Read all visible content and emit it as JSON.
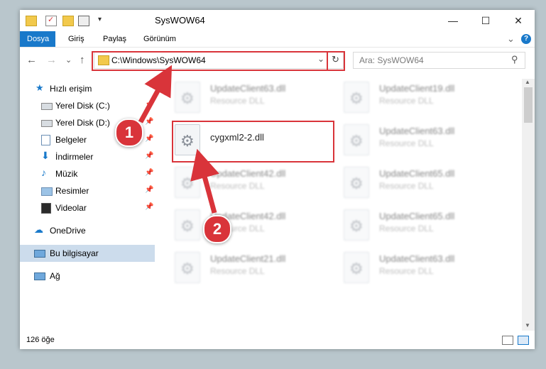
{
  "window": {
    "title": "SysWOW64",
    "minimize_glyph": "—",
    "maximize_glyph": "☐",
    "close_glyph": "✕"
  },
  "ribbon": {
    "tabs": [
      "Dosya",
      "Giriş",
      "Paylaş",
      "Görünüm"
    ],
    "expand_glyph": "⌄",
    "help_glyph": "?"
  },
  "navbar": {
    "back_glyph": "←",
    "forward_glyph": "→",
    "recent_glyph": "⌄",
    "up_glyph": "↑",
    "address": "C:\\Windows\\SysWOW64",
    "refresh_glyph": "↻",
    "search_placeholder": "Ara: SysWOW64",
    "search_glyph": "⚲"
  },
  "sidebar": {
    "items": [
      {
        "label": "Hızlı erişim",
        "icon": "star-icon"
      },
      {
        "label": "Yerel Disk (C:)",
        "icon": "drive-icon"
      },
      {
        "label": "Yerel Disk (D:)",
        "icon": "drive-icon"
      },
      {
        "label": "Belgeler",
        "icon": "documents-icon"
      },
      {
        "label": "İndirmeler",
        "icon": "download-icon"
      },
      {
        "label": "Müzik",
        "icon": "music-icon"
      },
      {
        "label": "Resimler",
        "icon": "pictures-icon"
      },
      {
        "label": "Videolar",
        "icon": "video-icon"
      },
      {
        "label": "OneDrive",
        "icon": "cloud-icon"
      },
      {
        "label": "Bu bilgisayar",
        "icon": "computer-icon"
      },
      {
        "label": "Ağ",
        "icon": "network-icon"
      }
    ],
    "pin_glyph": "📌"
  },
  "files": {
    "highlighted": {
      "name": "cygxml2-2.dll"
    },
    "left_column": [
      {
        "name": "UpdateClient63.dll",
        "type": "Resource DLL"
      },
      {
        "name": "UpdateClient42.dll",
        "type": "Resource DLL"
      },
      {
        "name": "UpdateClient42.dll",
        "type": "Resource DLL"
      },
      {
        "name": "UpdateClient21.dll",
        "type": "Resource DLL"
      }
    ],
    "right_column": [
      {
        "name": "UpdateClient19.dll",
        "type": "Resource DLL"
      },
      {
        "name": "UpdateClient63.dll",
        "type": "Resource DLL"
      },
      {
        "name": "UpdateClient65.dll",
        "type": "Resource DLL"
      },
      {
        "name": "UpdateClient65.dll",
        "type": "Resource DLL"
      },
      {
        "name": "UpdateClient63.dll",
        "type": "Resource DLL"
      }
    ]
  },
  "status": {
    "item_count": "126 öğe"
  },
  "callouts": {
    "one": "1",
    "two": "2"
  },
  "colors": {
    "accent": "#1979ca",
    "highlight": "#d9343a",
    "selected": "#ccdcec"
  }
}
